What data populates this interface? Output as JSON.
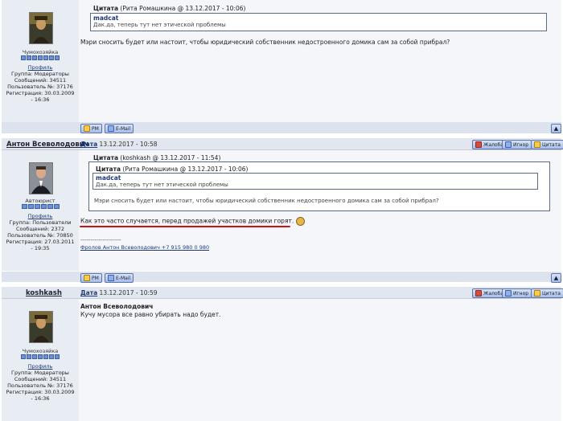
{
  "post1": {
    "role": "Чумохозяйка",
    "meta": {
      "profile": "Профиль",
      "group": "Группа: Модераторы",
      "messages": "Сообщений: 34511",
      "user_no": "Пользователь №: 37176",
      "registered": "Регистрация: 30.03.2009 - 16:36"
    },
    "quote": {
      "header_label": "Цитата",
      "header_source": "(Рита Ромашкина @ 13.12.2017 - 10:06)",
      "inner_author": "madcat",
      "inner_text": "Дак.да, теперь тут нет этической проблемы"
    },
    "text": "Мэри сносить будет или настоит, чтобы юридический собственник недостроенного домика сам за собой прибрал?",
    "buttons": {
      "pm": "PM",
      "email": "E-Mail"
    }
  },
  "post2": {
    "author": "Антон Всеволодович",
    "date_label": "Дата",
    "date": "13.12.2017 - 10:58",
    "role": "Автоюрист",
    "meta": {
      "profile": "Профиль",
      "group": "Группа: Пользователи",
      "messages": "Сообщений: 2372",
      "user_no": "Пользователь №: 70850",
      "registered": "Регистрация: 27.03.2011 - 19:35"
    },
    "actions": {
      "complaint": "Жалоба",
      "ignore": "Игнор",
      "quote": "Цитата"
    },
    "outer_quote": {
      "header_label": "Цитата",
      "header_source": "(koshkash @ 13.12.2017 - 11:54)"
    },
    "inner_quote": {
      "header_label": "Цитата",
      "header_source": "(Рита Ромашкина @ 13.12.2017 - 10:06)",
      "inner_author": "madcat",
      "inner_text": "Дак.да, теперь тут нет этической проблемы"
    },
    "quoted_text": "Мэри сносить будет или настоит, чтобы юридический собственник недостроенного домика сам за собой прибрал?",
    "text": "Как это часто случается, перед продажей участков домики горят.",
    "sig_dashes": "--------------------",
    "signature": "Фролов Антон Всеволодович +7 915 980 0 980",
    "buttons": {
      "pm": "PM",
      "email": "E-Mail"
    }
  },
  "post3": {
    "author": "koshkash",
    "date_label": "Дата",
    "date": "13.12.2017 - 10:59",
    "role": "Чумохозяйка",
    "meta": {
      "profile": "Профиль",
      "group": "Группа: Модераторы",
      "messages": "Сообщений: 34511",
      "user_no": "Пользователь №: 37176",
      "registered": "Регистрация: 30.03.2009 - 16:36"
    },
    "actions": {
      "complaint": "Жалоба",
      "ignore": "Игнор",
      "quote": "Цитата"
    },
    "reply_to": "Антон Всеволодович",
    "text": "Кучу мусора все равно убирать надо будет."
  },
  "colors": {
    "underline": "#cc1111",
    "button_blue": "#a9bde6",
    "sidebar": "#e8ecf3"
  }
}
